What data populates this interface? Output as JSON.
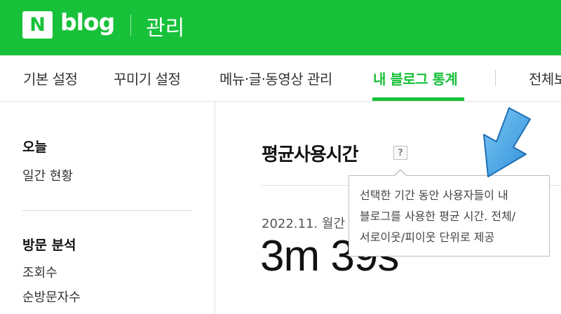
{
  "header": {
    "logo_letter": "N",
    "logo_word": "blog",
    "title": "관리"
  },
  "nav": {
    "items": [
      {
        "label": "기본 설정"
      },
      {
        "label": "꾸미기 설정"
      },
      {
        "label": "메뉴·글·동영상 관리"
      },
      {
        "label": "내 블로그 통계"
      },
      {
        "label": "전체보"
      }
    ],
    "active_index": 3
  },
  "sidebar": {
    "sections": [
      {
        "heading": "오늘",
        "items": [
          "일간 현황"
        ]
      },
      {
        "heading": "방문 분석",
        "items": [
          "조회수",
          "순방문자수"
        ]
      }
    ]
  },
  "main": {
    "title": "평균사용시간",
    "help_glyph": "?",
    "period": "2022.11. 월간",
    "value": "3m 39s"
  },
  "tooltip": {
    "lines": [
      "선택한 기간 동안 사용자들이 내",
      "블로그를 사용한 평균 시간. 전체/",
      "서로이웃/피이웃 단위로 제공"
    ]
  },
  "colors": {
    "brand_green": "#17c139",
    "pointer_blue": "#3a9ce0"
  },
  "icons": {
    "help": "question-mark-icon",
    "pointer": "arrow-down-left-icon"
  }
}
